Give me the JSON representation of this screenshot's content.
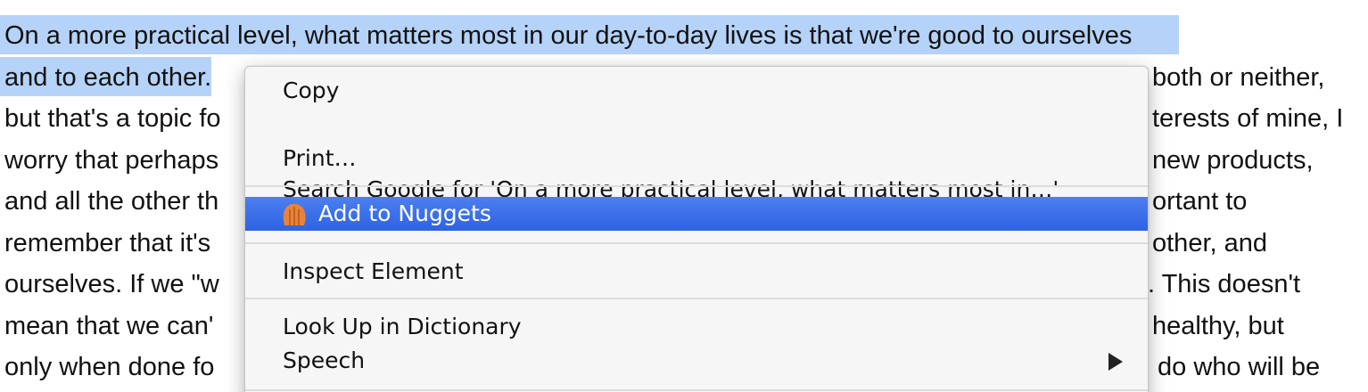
{
  "article": {
    "lines": [
      "On a more practical level, what matters most in our day-to-day lives is that we're good to ourselves",
      "and to each other.",
      "both or neither,",
      "but that's a topic fo",
      "terests of mine, I",
      "worry that perhaps",
      "new products,",
      "and all the other th",
      "ortant to",
      "remember that it's",
      "other, and",
      "ourselves. If we \"w",
      ". This doesn't",
      "mean that we can'",
      "healthy, but",
      "only when done fo",
      "do who will be"
    ]
  },
  "context_menu": {
    "copy": "Copy",
    "search": "Search Google for 'On a more practical level, what matters most in…'",
    "print": "Print…",
    "add_to_nuggets": "Add to Nuggets",
    "inspect": "Inspect Element",
    "look_up": "Look Up in Dictionary",
    "speech": "Speech"
  },
  "colors": {
    "selection": "#b5d3f8",
    "highlight": "#3d6ee8",
    "nugget_icon": "#e8833a"
  },
  "icons": {
    "nuggets": "nugget-icon",
    "submenu": "chevron-right-icon"
  }
}
